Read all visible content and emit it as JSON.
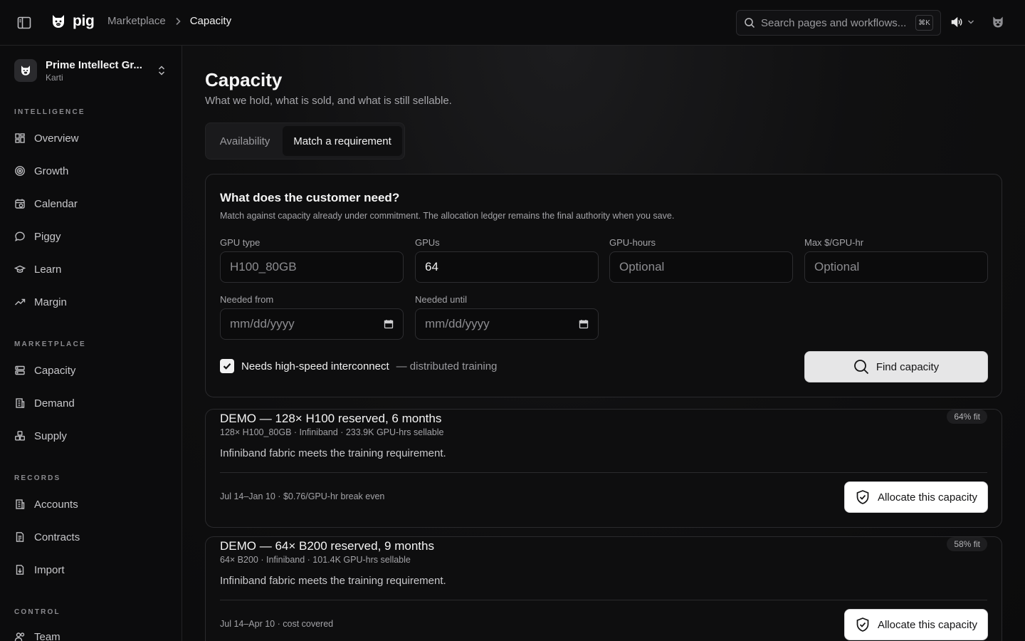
{
  "topbar": {
    "brand": "pig",
    "breadcrumb": [
      "Marketplace",
      "Capacity"
    ],
    "search_placeholder": "Search pages and workflows...",
    "search_shortcut": "⌘K"
  },
  "sidebar": {
    "org_name": "Prime Intellect Gr...",
    "org_user": "Karti",
    "sections": [
      {
        "label": "INTELLIGENCE",
        "items": [
          "Overview",
          "Growth",
          "Calendar",
          "Piggy",
          "Learn",
          "Margin"
        ]
      },
      {
        "label": "MARKETPLACE",
        "items": [
          "Capacity",
          "Demand",
          "Supply"
        ]
      },
      {
        "label": "RECORDS",
        "items": [
          "Accounts",
          "Contracts",
          "Import"
        ]
      },
      {
        "label": "CONTROL",
        "items": [
          "Team"
        ]
      }
    ]
  },
  "page": {
    "title": "Capacity",
    "subtitle": "What we hold, what is sold, and what is still sellable.",
    "tabs": [
      "Availability",
      "Match a requirement"
    ],
    "active_tab": "Match a requirement"
  },
  "form": {
    "title": "What does the customer need?",
    "description": "Match against capacity already under commitment. The allocation ledger remains the final authority when you save.",
    "fields": {
      "gpu_type": {
        "label": "GPU type",
        "value": "",
        "placeholder": "H100_80GB"
      },
      "gpus": {
        "label": "GPUs",
        "value": "64",
        "placeholder": ""
      },
      "gpu_hours": {
        "label": "GPU-hours",
        "value": "",
        "placeholder": "Optional"
      },
      "max_price": {
        "label": "Max $/GPU-hr",
        "value": "",
        "placeholder": "Optional"
      },
      "needed_from": {
        "label": "Needed from",
        "value": "",
        "placeholder": "mm/dd/yyyy"
      },
      "needed_until": {
        "label": "Needed until",
        "value": "",
        "placeholder": "mm/dd/yyyy"
      }
    },
    "interconnect": {
      "checked": true,
      "label": "Needs high-speed interconnect",
      "hint": "— distributed training"
    },
    "submit_label": "Find capacity"
  },
  "results": [
    {
      "title": "DEMO — 128× H100 reserved, 6 months",
      "meta": "128× H100_80GB · Infiniband · 233.9K GPU-hrs sellable",
      "body": "Infiniband fabric meets the training requirement.",
      "footer": "Jul 14–Jan 10 · $0.76/GPU-hr break even",
      "fit": "64% fit",
      "action": "Allocate this capacity"
    },
    {
      "title": "DEMO — 64× B200 reserved, 9 months",
      "meta": "64× B200 · Infiniband · 101.4K GPU-hrs sellable",
      "body": "Infiniband fabric meets the training requirement.",
      "footer": "Jul 14–Apr 10 · cost covered",
      "fit": "58% fit",
      "action": "Allocate this capacity"
    }
  ],
  "colors": {
    "background": "#0b0b0c",
    "accent_button": "#e6e6e7",
    "text": "#ededed"
  }
}
